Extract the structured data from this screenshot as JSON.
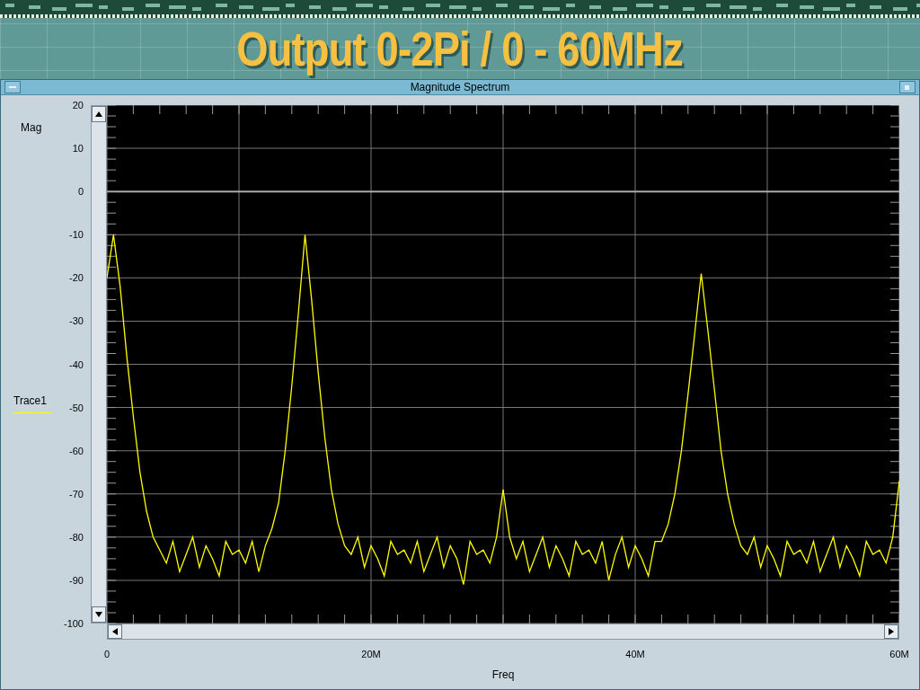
{
  "banner": {
    "title": "Output 0-2Pi / 0 - 60MHz"
  },
  "window": {
    "title": "Magnitude Spectrum"
  },
  "chart_data": {
    "type": "line",
    "xlabel": "Freq",
    "ylabel": "Mag",
    "xlim": [
      0,
      60
    ],
    "ylim": [
      -100,
      20
    ],
    "grid": true,
    "x": [
      0,
      0.5,
      1,
      1.5,
      2,
      2.5,
      3,
      3.5,
      4,
      4.5,
      5,
      5.5,
      6,
      6.5,
      7,
      7.5,
      8,
      8.5,
      9,
      9.5,
      10,
      10.5,
      11,
      11.5,
      12,
      12.5,
      13,
      13.5,
      14,
      14.5,
      15,
      15.5,
      16,
      16.5,
      17,
      17.5,
      18,
      18.5,
      19,
      19.5,
      20,
      20.5,
      21,
      21.5,
      22,
      22.5,
      23,
      23.5,
      24,
      24.5,
      25,
      25.5,
      26,
      26.5,
      27,
      27.5,
      28,
      28.5,
      29,
      29.5,
      30,
      30.5,
      31,
      31.5,
      32,
      32.5,
      33,
      33.5,
      34,
      34.5,
      35,
      35.5,
      36,
      36.5,
      37,
      37.5,
      38,
      38.5,
      39,
      39.5,
      40,
      40.5,
      41,
      41.5,
      42,
      42.5,
      43,
      43.5,
      44,
      44.5,
      45,
      45.5,
      46,
      46.5,
      47,
      47.5,
      48,
      48.5,
      49,
      49.5,
      50,
      50.5,
      51,
      51.5,
      52,
      52.5,
      53,
      53.5,
      54,
      54.5,
      55,
      55.5,
      56,
      56.5,
      57,
      57.5,
      58,
      58.5,
      59,
      59.5,
      60
    ],
    "xticks": [
      {
        "value": 0,
        "label": "0"
      },
      {
        "value": 20,
        "label": "20M"
      },
      {
        "value": 40,
        "label": "40M"
      },
      {
        "value": 60,
        "label": "60M"
      }
    ],
    "yticks": [
      20,
      10,
      0,
      -10,
      -20,
      -30,
      -40,
      -50,
      -60,
      -70,
      -80,
      -90,
      -100
    ],
    "series": [
      {
        "name": "Trace1",
        "color": "#ffff00",
        "values": [
          -20,
          -10,
          -22,
          -38,
          -52,
          -65,
          -74,
          -80,
          -83,
          -86,
          -81,
          -88,
          -84,
          -80,
          -87,
          -82,
          -85,
          -89,
          -81,
          -84,
          -83,
          -86,
          -81,
          -88,
          -82,
          -78,
          -72,
          -60,
          -45,
          -28,
          -10,
          -25,
          -42,
          -57,
          -69,
          -77,
          -82,
          -84,
          -80,
          -87,
          -82,
          -85,
          -89,
          -81,
          -84,
          -83,
          -86,
          -81,
          -88,
          -84,
          -80,
          -87,
          -82,
          -85,
          -91,
          -81,
          -84,
          -83,
          -86,
          -80,
          -69,
          -80,
          -85,
          -81,
          -88,
          -84,
          -80,
          -87,
          -82,
          -85,
          -89,
          -81,
          -84,
          -83,
          -86,
          -81,
          -90,
          -84,
          -80,
          -87,
          -82,
          -85,
          -89,
          -81,
          -81,
          -77,
          -70,
          -60,
          -47,
          -33,
          -19,
          -32,
          -46,
          -60,
          -70,
          -77,
          -82,
          -84,
          -80,
          -87,
          -82,
          -85,
          -89,
          -81,
          -84,
          -83,
          -86,
          -81,
          -88,
          -84,
          -80,
          -87,
          -82,
          -85,
          -89,
          -81,
          -84,
          -83,
          -86,
          -80,
          -67
        ]
      }
    ]
  }
}
